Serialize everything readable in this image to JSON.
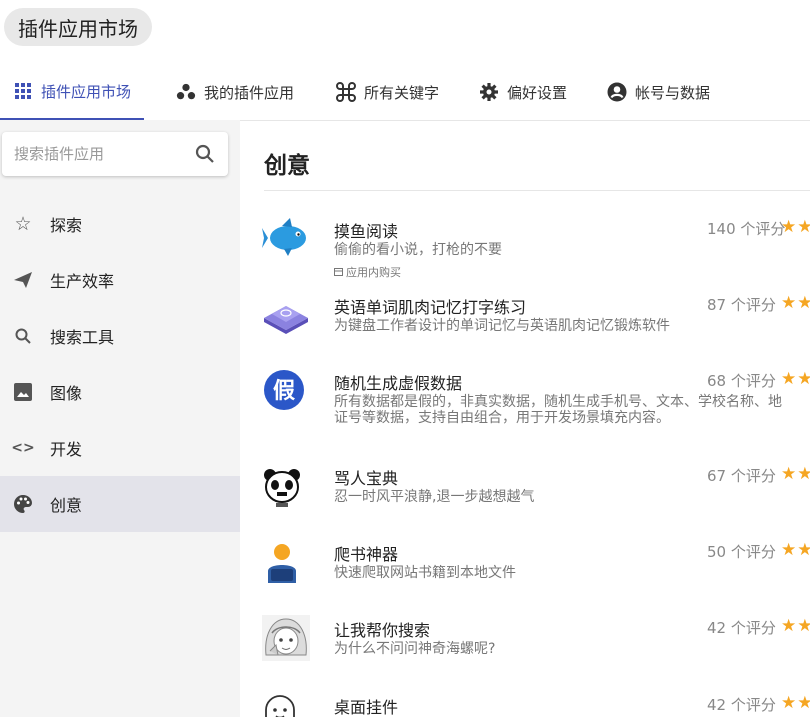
{
  "window": {
    "title": "插件应用市场"
  },
  "tabs": [
    {
      "label": "插件应用市场",
      "icon": "grid-icon",
      "active": true
    },
    {
      "label": "我的插件应用",
      "icon": "bubbles-icon",
      "active": false
    },
    {
      "label": "所有关键字",
      "icon": "command-icon",
      "active": false
    },
    {
      "label": "偏好设置",
      "icon": "gear-icon",
      "active": false
    },
    {
      "label": "帐号与数据",
      "icon": "account-icon",
      "active": false
    }
  ],
  "search": {
    "placeholder": "搜索插件应用",
    "value": ""
  },
  "sidebar": {
    "items": [
      {
        "label": "探索",
        "icon": "star-outline-icon"
      },
      {
        "label": "生产效率",
        "icon": "send-icon"
      },
      {
        "label": "搜索工具",
        "icon": "search-icon"
      },
      {
        "label": "图像",
        "icon": "image-icon"
      },
      {
        "label": "开发",
        "icon": "code-icon"
      },
      {
        "label": "创意",
        "icon": "palette-icon",
        "active": true
      }
    ]
  },
  "main": {
    "title": "创意",
    "apps": [
      {
        "name": "摸鱼阅读",
        "desc": "偷偷的看小说，打枪的不要",
        "tag": "应用内购买",
        "rating": "140 个评分",
        "icon": "fish-icon"
      },
      {
        "name": "英语单词肌肉记忆打字练习",
        "desc": "为键盘工作者设计的单词记忆与英语肌肉记忆锻炼软件",
        "rating": "87 个评分",
        "icon": "keycap-icon"
      },
      {
        "name": "随机生成虚假数据",
        "desc": "所有数据都是假的，非真实数据，随机生成手机号、文本、学校名称、地",
        "desc2": "证号等数据，支持自由组合，用于开发场景填充内容。",
        "rating": "68 个评分",
        "icon": "fake-badge-icon",
        "icon_text": "假"
      },
      {
        "name": "骂人宝典",
        "desc": "忍一时风平浪静,退一步越想越气",
        "rating": "67 个评分",
        "icon": "panda-meme-icon"
      },
      {
        "name": "爬书神器",
        "desc": "快速爬取网站书籍到本地文件",
        "rating": "50 个评分",
        "icon": "reader-person-icon"
      },
      {
        "name": "让我帮你搜索",
        "desc": "为什么不问问神奇海螺呢?",
        "rating": "42 个评分",
        "icon": "anime-girl-icon"
      },
      {
        "name": "桌面挂件",
        "rating": "42 个评分",
        "icon": "ghost-icon"
      }
    ]
  },
  "colors": {
    "accent": "#3f51b5",
    "star": "#f5a623",
    "sidebar_bg": "#f4f4f4",
    "active_nav_bg": "#e3e3ea"
  }
}
